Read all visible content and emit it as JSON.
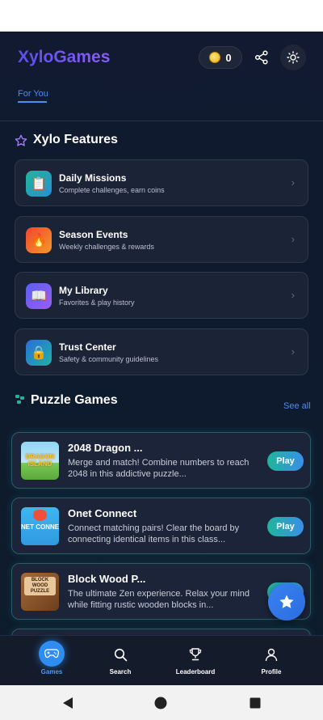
{
  "app": {
    "title": "XyloGames",
    "coins": "0",
    "tabs": [
      {
        "label": "For You"
      }
    ]
  },
  "features": {
    "title": "Xylo Features",
    "items": [
      {
        "title": "Daily Missions",
        "subtitle": "Complete challenges, earn coins",
        "icon": "clipboard-icon",
        "color": "#1fa7a0"
      },
      {
        "title": "Season Events",
        "subtitle": "Weekly challenges & rewards",
        "icon": "fire-icon",
        "color": "#f0602a"
      },
      {
        "title": "My Library",
        "subtitle": "Favorites & play history",
        "icon": "book-icon",
        "color": "#6a5ef0"
      },
      {
        "title": "Trust Center",
        "subtitle": "Safety & community guidelines",
        "icon": "lock-icon",
        "color": "#2f7fd8"
      }
    ]
  },
  "puzzle": {
    "title": "Puzzle Games",
    "see_all": "See all",
    "games": [
      {
        "title": "2048 Dragon ...",
        "description": "Merge and match! Combine numbers to reach 2048 in this addictive puzzle...",
        "play": "Play",
        "thumb_text": "DRAGON ISLAND"
      },
      {
        "title": "Onet Connect",
        "description": "Connect matching pairs! Clear the board by connecting identical items in this class...",
        "play": "Play",
        "thumb_text": "NET CONNE"
      },
      {
        "title": "Block Wood P...",
        "description": "The ultimate Zen experience. Relax your mind while fitting rustic wooden blocks in...",
        "play": "Play",
        "thumb_text": "BLOCK WOOD PUZZLE"
      }
    ]
  },
  "nav": {
    "items": [
      {
        "label": "Games",
        "icon": "gamepad-icon"
      },
      {
        "label": "Search",
        "icon": "search-icon"
      },
      {
        "label": "Leaderboard",
        "icon": "trophy-icon"
      },
      {
        "label": "Profile",
        "icon": "user-icon"
      }
    ]
  },
  "colors": {
    "accent": "#4f8cf2",
    "background": "#111a30",
    "card": "#1b2336"
  }
}
